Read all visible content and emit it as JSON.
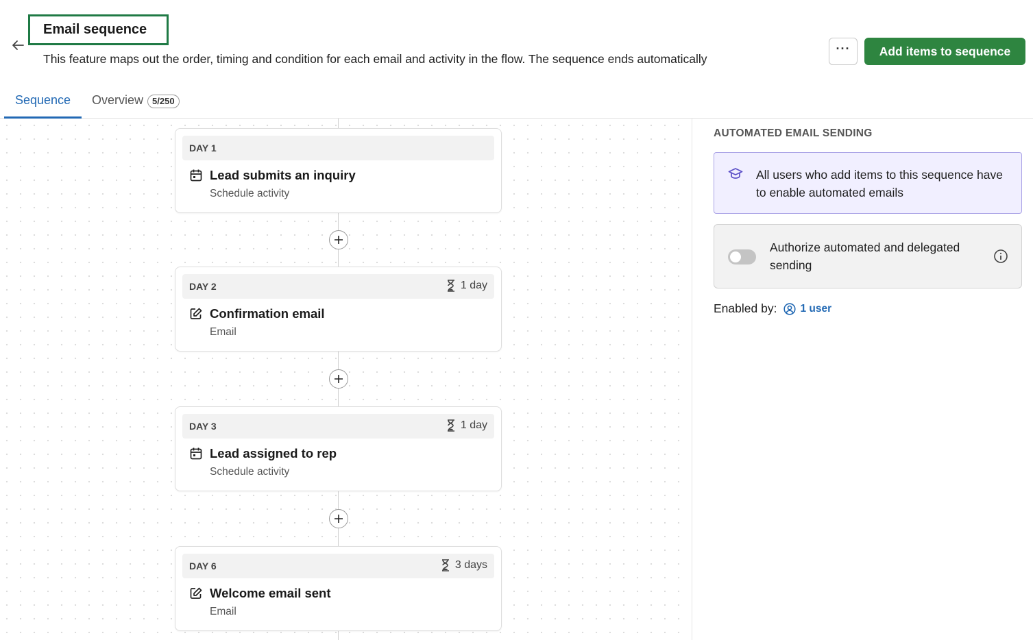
{
  "header": {
    "title": "Email sequence",
    "description": "This feature maps out the order, timing and condition for each email and activity in the flow. The sequence ends automatically",
    "more_label": "···",
    "add_button_label": "Add items to sequence"
  },
  "tabs": [
    {
      "label": "Sequence",
      "active": true
    },
    {
      "label": "Overview",
      "badge": "5/250",
      "active": false
    }
  ],
  "sequence": [
    {
      "day": "DAY 1",
      "delay": "",
      "icon": "calendar-icon",
      "title": "Lead submits an inquiry",
      "subtitle": "Schedule activity"
    },
    {
      "day": "DAY 2",
      "delay": "1 day",
      "icon": "edit-icon",
      "title": "Confirmation email",
      "subtitle": "Email"
    },
    {
      "day": "DAY 3",
      "delay": "1 day",
      "icon": "calendar-icon",
      "title": "Lead assigned to rep",
      "subtitle": "Schedule activity"
    },
    {
      "day": "DAY 6",
      "delay": "3 days",
      "icon": "edit-icon",
      "title": "Welcome email sent",
      "subtitle": "Email"
    }
  ],
  "panel": {
    "heading": "AUTOMATED EMAIL SENDING",
    "info_text": "All users who add items to this sequence have to enable automated emails",
    "authorize_text": "Authorize automated and delegated sending",
    "authorize_enabled": false,
    "enabled_by_label": "Enabled by:",
    "enabled_users": "1 user"
  },
  "colors": {
    "primary_green": "#2e8540",
    "title_border": "#1f7a45",
    "link_blue": "#2269b4",
    "info_bg": "#f1efff",
    "info_border": "#a9a2e6"
  }
}
